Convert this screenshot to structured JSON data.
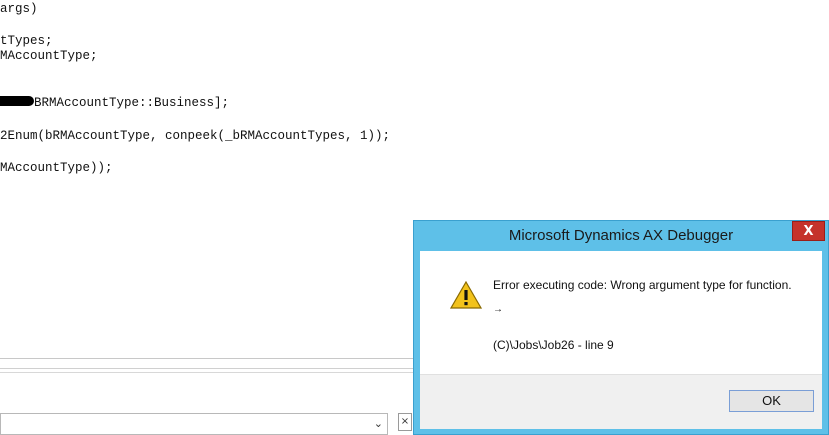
{
  "editor": {
    "lines": [
      "args)",
      "tTypes;",
      "MAccountType;",
      "BRMAccountType::Business];",
      "2Enum(bRMAccountType, conpeek(_bRMAccountTypes, 1));",
      "MAccountType));"
    ]
  },
  "dialog": {
    "title": "Microsoft Dynamics AX Debugger",
    "close_glyph": "X",
    "error_text": "Error executing code: Wrong argument type for function.",
    "arrow_glyph": "→",
    "location_text": "(C)\\Jobs\\Job26 - line 9",
    "ok_label": "OK",
    "icon": "warning-icon"
  },
  "bottom": {
    "dropdown_arrow": "⌄",
    "close_glyph": "×"
  },
  "colors": {
    "dialog_frame": "#5ec0e8",
    "close_button": "#c5332b",
    "warning_fill": "#f2c21b"
  }
}
